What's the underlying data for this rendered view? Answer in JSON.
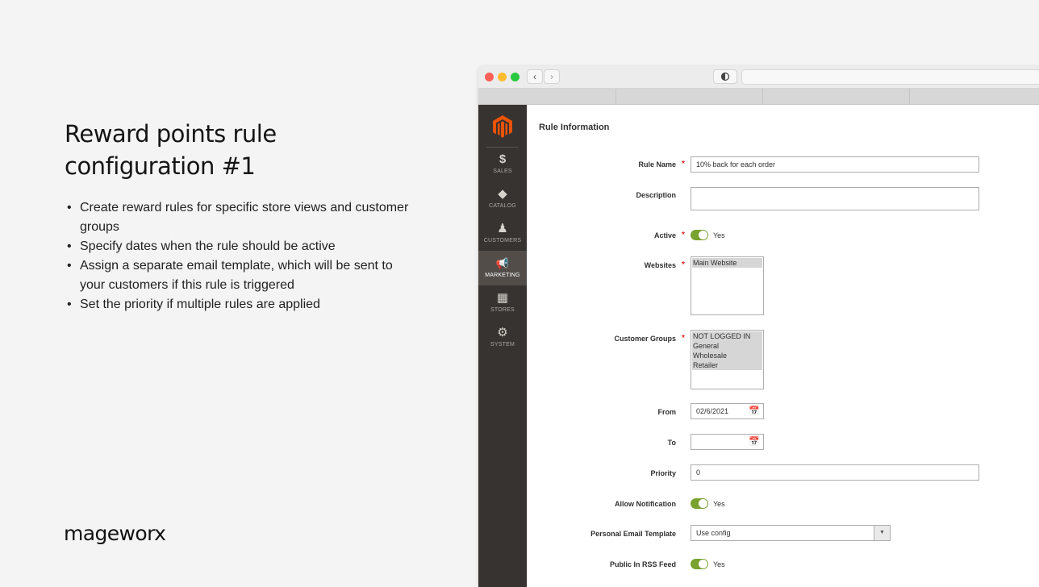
{
  "intro": {
    "title_line1": "Reward points rule",
    "title_line2": "configuration #1",
    "bullets": [
      "Create reward rules for specific store views and customer groups",
      "Specify dates when the rule should be active",
      "Assign a separate email template, which will be sent to your customers if this rule is triggered",
      "Set the priority if multiple rules are applied"
    ],
    "brand": "mageworx"
  },
  "sidebar": {
    "items": [
      {
        "label": "SALES",
        "icon": "dollar-icon",
        "glyph": "$"
      },
      {
        "label": "CATALOG",
        "icon": "cube-icon",
        "glyph": "◆"
      },
      {
        "label": "CUSTOMERS",
        "icon": "person-icon",
        "glyph": "♟"
      },
      {
        "label": "MARKETING",
        "icon": "megaphone-icon",
        "glyph": "📢"
      },
      {
        "label": "STORES",
        "icon": "store-icon",
        "glyph": "▦"
      },
      {
        "label": "SYSTEM",
        "icon": "gear-icon",
        "glyph": "⚙"
      }
    ],
    "active": "MARKETING"
  },
  "form": {
    "section_title": "Rule Information",
    "rule_name": {
      "label": "Rule Name",
      "value": "10% back for each order"
    },
    "description": {
      "label": "Description",
      "value": ""
    },
    "active": {
      "label": "Active",
      "value": "Yes"
    },
    "websites": {
      "label": "Websites",
      "options": [
        "Main Website"
      ]
    },
    "customer_groups": {
      "label": "Customer Groups",
      "options": [
        "NOT LOGGED IN",
        "General",
        "Wholesale",
        "Retailer"
      ]
    },
    "from": {
      "label": "From",
      "value": "02/6/2021"
    },
    "to": {
      "label": "To",
      "value": ""
    },
    "priority": {
      "label": "Priority",
      "value": "0"
    },
    "allow_notification": {
      "label": "Allow Notification",
      "value": "Yes"
    },
    "email_template": {
      "label": "Personal Email Template",
      "value": "Use config"
    },
    "rss_feed": {
      "label": "Public In RSS Feed",
      "value": "Yes"
    }
  },
  "colors": {
    "accent_toggle": "#79a22e",
    "required": "#e22626",
    "sidebar_bg": "#373330",
    "logo": "#eb5202"
  }
}
